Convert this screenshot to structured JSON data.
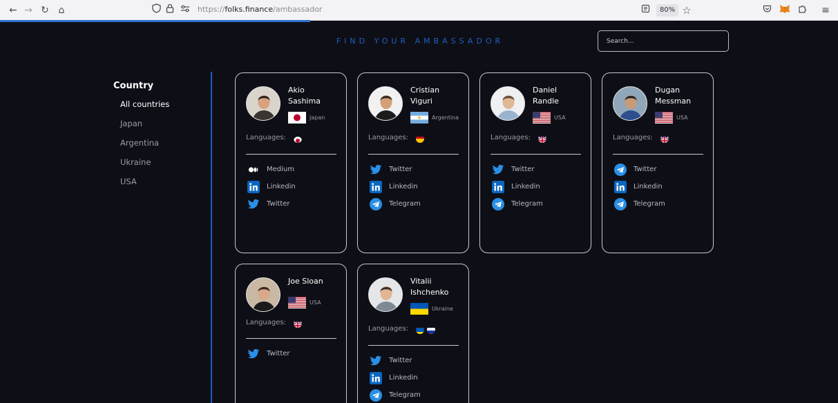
{
  "browser": {
    "url_prefix": "https://",
    "url_domain": "folks.finance",
    "url_path": "/ambassador",
    "zoom": "80%",
    "icons": [
      "back-icon",
      "forward-icon",
      "reload-icon",
      "home-icon",
      "shield-icon",
      "lock-icon",
      "permissions-icon",
      "reader-icon",
      "bookmark-star-icon",
      "pocket-icon",
      "metamask-icon",
      "extensions-icon",
      "menu-icon"
    ]
  },
  "header": {
    "title": "FIND YOUR AMBASSADOR",
    "search_placeholder": "Search..."
  },
  "sidebar": {
    "heading": "Country",
    "items": [
      "All countries",
      "Japan",
      "Argentina",
      "Ukraine",
      "USA"
    ],
    "active": "All countries"
  },
  "languages_label": "Languages:",
  "accent_color": "#1f5fc4",
  "ambassadors": [
    {
      "name_line1": "Akio",
      "name_line2": "Sashima",
      "country": "Japan",
      "flag": "japan",
      "languages": [
        "japan"
      ],
      "links": [
        {
          "label": "Medium",
          "icon": "medium-icon"
        },
        {
          "label": "Linkedin",
          "icon": "linkedin-icon"
        },
        {
          "label": "Twitter",
          "icon": "twitter-icon"
        }
      ]
    },
    {
      "name_line1": "Cristian",
      "name_line2": "Viguri",
      "country": "Argentina",
      "flag": "argentina",
      "languages": [
        "spain"
      ],
      "links": [
        {
          "label": "Twitter",
          "icon": "twitter-icon"
        },
        {
          "label": "Linkedin",
          "icon": "linkedin-icon"
        },
        {
          "label": "Telegram",
          "icon": "telegram-icon"
        }
      ]
    },
    {
      "name_line1": "Daniel",
      "name_line2": "Randle",
      "country": "USA",
      "flag": "usa",
      "languages": [
        "uk"
      ],
      "links": [
        {
          "label": "Twitter",
          "icon": "twitter-icon"
        },
        {
          "label": "Linkedin",
          "icon": "linkedin-icon"
        },
        {
          "label": "Telegram",
          "icon": "telegram-icon"
        }
      ]
    },
    {
      "name_line1": "Dugan",
      "name_line2": "Messman",
      "country": "USA",
      "flag": "usa",
      "languages": [
        "uk"
      ],
      "links": [
        {
          "label": "Twitter",
          "icon": "telegram-icon"
        },
        {
          "label": "Linkedin",
          "icon": "linkedin-icon"
        },
        {
          "label": "Telegram",
          "icon": "telegram-icon"
        }
      ]
    },
    {
      "name_line1": "Joe Sloan",
      "name_line2": "",
      "country": "USA",
      "flag": "usa",
      "languages": [
        "uk"
      ],
      "links": [
        {
          "label": "Twitter",
          "icon": "twitter-icon"
        }
      ]
    },
    {
      "name_line1": "Vitalii",
      "name_line2": "Ishchenko",
      "country": "Ukraine",
      "flag": "ukraine",
      "languages": [
        "ukraine",
        "russia"
      ],
      "links": [
        {
          "label": "Twitter",
          "icon": "twitter-icon"
        },
        {
          "label": "Linkedin",
          "icon": "linkedin-icon"
        },
        {
          "label": "Telegram",
          "icon": "telegram-icon"
        }
      ]
    }
  ]
}
